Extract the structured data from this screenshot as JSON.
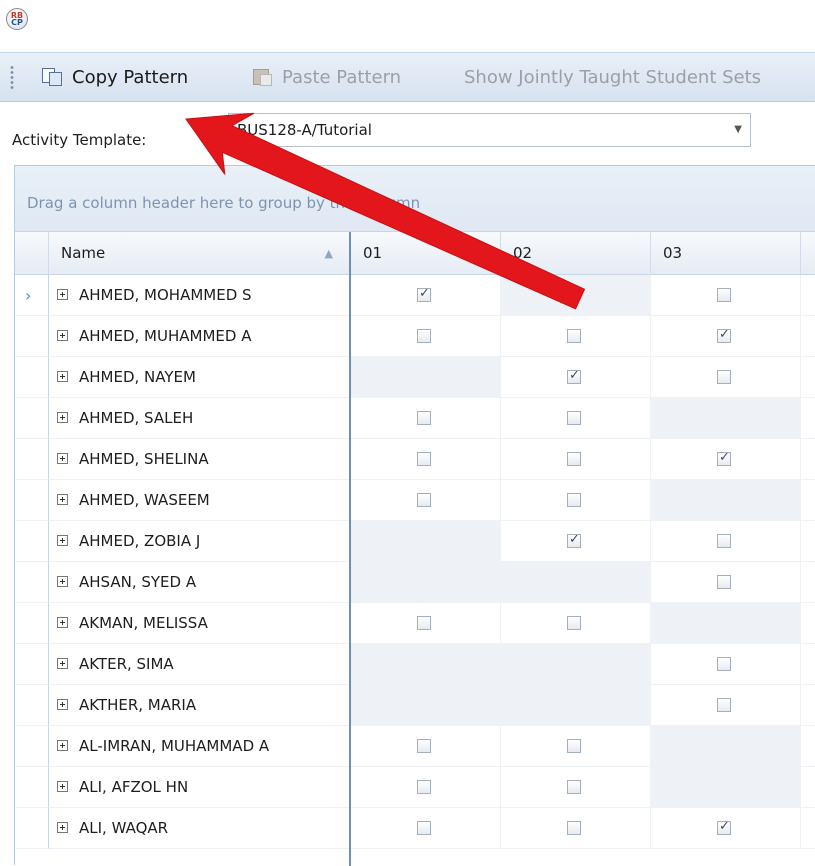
{
  "toolbar": {
    "copy_label": "Copy Pattern",
    "paste_label": "Paste Pattern",
    "jointly_label": "Show Jointly Taught Student Sets"
  },
  "template": {
    "label": "Activity Template:",
    "value": "BUS128-A/Tutorial"
  },
  "grid": {
    "group_hint": "Drag a column header here to group by that column",
    "columns": [
      "Name",
      "01",
      "02",
      "03"
    ],
    "rows": [
      {
        "name": "AHMED, MOHAMMED S",
        "c01": "checked",
        "c02": "none",
        "c03": "unchecked"
      },
      {
        "name": "AHMED, MUHAMMED A",
        "c01": "unchecked",
        "c02": "unchecked",
        "c03": "checked"
      },
      {
        "name": "AHMED, NAYEM",
        "c01": "none",
        "c02": "checked",
        "c03": "unchecked"
      },
      {
        "name": "AHMED, SALEH",
        "c01": "unchecked",
        "c02": "unchecked",
        "c03": "none"
      },
      {
        "name": "AHMED, SHELINA",
        "c01": "unchecked",
        "c02": "unchecked",
        "c03": "checked"
      },
      {
        "name": "AHMED, WASEEM",
        "c01": "unchecked",
        "c02": "unchecked",
        "c03": "none"
      },
      {
        "name": "AHMED, ZOBIA J",
        "c01": "none",
        "c02": "checked",
        "c03": "unchecked"
      },
      {
        "name": "AHSAN, SYED A",
        "c01": "none",
        "c02": "none",
        "c03": "unchecked"
      },
      {
        "name": "AKMAN, MELISSA",
        "c01": "unchecked",
        "c02": "unchecked",
        "c03": "none"
      },
      {
        "name": "AKTER, SIMA",
        "c01": "none",
        "c02": "none",
        "c03": "unchecked"
      },
      {
        "name": "AKTHER, MARIA",
        "c01": "none",
        "c02": "none",
        "c03": "unchecked"
      },
      {
        "name": "AL-IMRAN, MUHAMMAD A",
        "c01": "unchecked",
        "c02": "unchecked",
        "c03": "none"
      },
      {
        "name": "ALI, AFZOL HN",
        "c01": "unchecked",
        "c02": "unchecked",
        "c03": "none"
      },
      {
        "name": "ALI, WAQAR",
        "c01": "unchecked",
        "c02": "unchecked",
        "c03": "checked"
      }
    ]
  },
  "icons": {
    "app": "app-logo-icon",
    "copy": "copy-icon",
    "paste": "paste-icon",
    "expand": "plus-expand-icon",
    "row_indicator": "chevron-right-icon",
    "sort": "sort-ascending-icon",
    "dropdown": "chevron-down-icon"
  },
  "colors": {
    "annotation_arrow": "#e3171b",
    "toolbar_bg": "#dde7f3",
    "hint_text": "#7f93b0",
    "pane_divider": "#6f8fb8"
  }
}
